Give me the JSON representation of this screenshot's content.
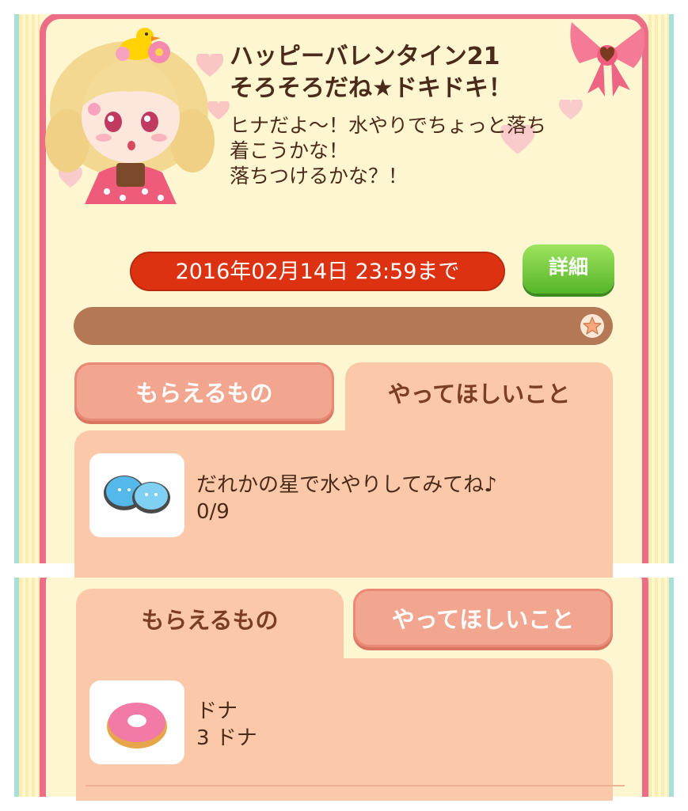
{
  "event": {
    "title_line1": "ハッピーバレンタイン21",
    "title_line2": "そろそろだね★ドキドキ！",
    "description_line1": "ヒナだよ～！水やりでちょっと落ち",
    "description_line2": "着こうかな！",
    "description_line3": "落ちつけるかな？！",
    "deadline": "2016年02月14日 23:59まで",
    "detail_label": "詳細",
    "progress_fraction": 0
  },
  "top_panel": {
    "tabs": [
      {
        "label": "もらえるもの",
        "active": false
      },
      {
        "label": "やってほしいこと",
        "active": true
      }
    ],
    "task": {
      "icon": "blue-droplets-icon",
      "text": "だれかの星で水やりしてみてね♪",
      "count": "0/9"
    }
  },
  "bottom_panel": {
    "tabs": [
      {
        "label": "もらえるもの",
        "active": true
      },
      {
        "label": "やってほしいこと",
        "active": false
      }
    ],
    "reward": {
      "icon": "donut-icon",
      "name": "ドナ",
      "amount": "3 ドナ"
    }
  },
  "colors": {
    "frame_pink": "#ec6d86",
    "background_cream": "#fef5d1",
    "deadline_red": "#dd3212",
    "detail_green": "#56b52a",
    "progress_brown": "#b47954",
    "tab_salmon": "#f2a690",
    "content_peach": "#fbc9a9",
    "text_brown": "#4a2a18"
  }
}
